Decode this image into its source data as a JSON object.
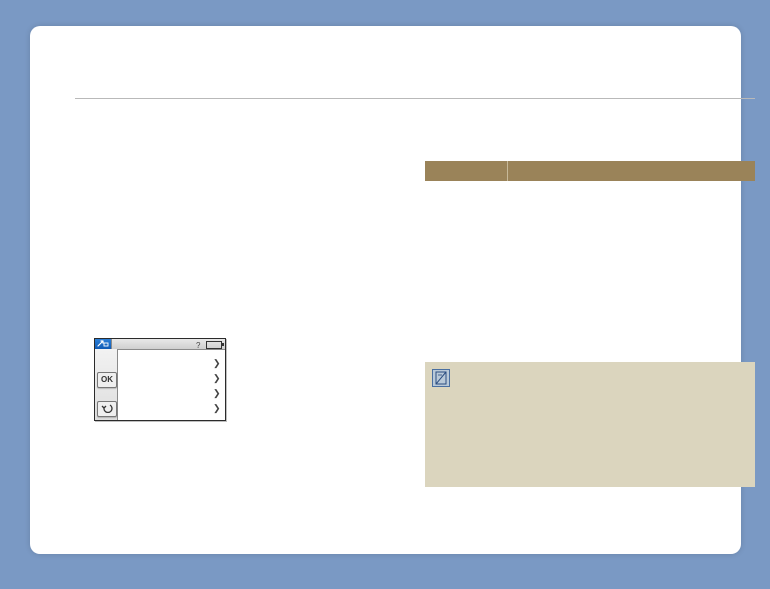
{
  "table_header": {
    "col1": "",
    "col2": ""
  },
  "camera_menu": {
    "ok_label": "OK",
    "items": [
      {
        "label": ""
      },
      {
        "label": ""
      },
      {
        "label": ""
      },
      {
        "label": ""
      }
    ]
  },
  "note": {
    "text": ""
  }
}
